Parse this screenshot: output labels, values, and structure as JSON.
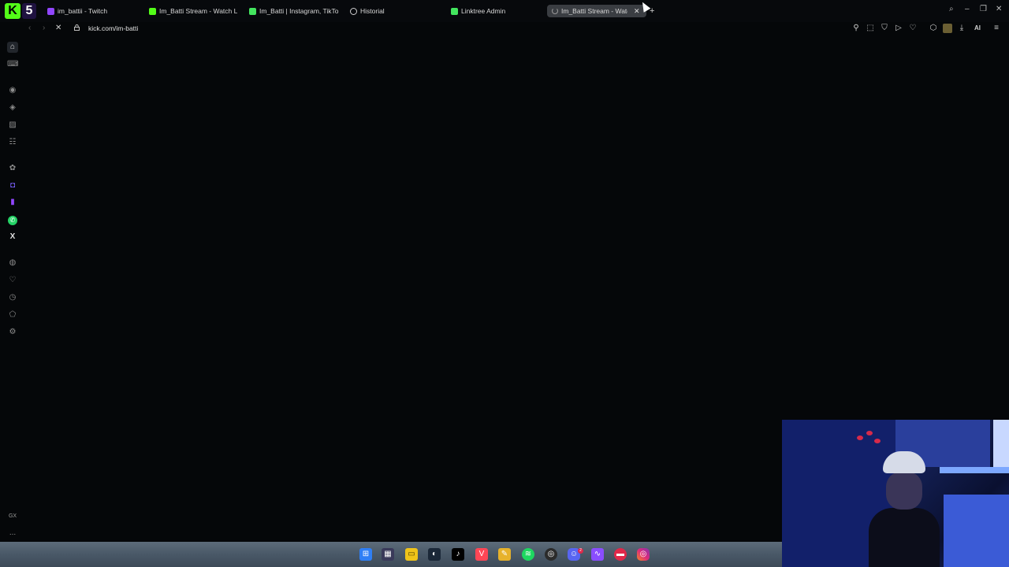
{
  "browser": {
    "logo_k": "K",
    "logo_5": "5",
    "tabs": [
      {
        "title": "im_battii - Twitch",
        "favicon": "twitch-icon"
      },
      {
        "title": "Im_Batti Stream - Watch L",
        "favicon": "kick-icon"
      },
      {
        "title": "Im_Batti | Instagram, TikTo",
        "favicon": "linktree-icon"
      },
      {
        "title": "Historial",
        "favicon": "history-icon"
      },
      {
        "title": "Linktree Admin",
        "favicon": "linktree-icon"
      },
      {
        "title": "Im_Batti Stream - Watc",
        "favicon": "loading-icon",
        "active": true
      }
    ],
    "address": {
      "url": "kick.com/im-batti"
    },
    "toolbar_ai_label": "AI"
  },
  "sidebar": {
    "gx_label": "GX",
    "more_label": "..."
  },
  "colors": {
    "kick_green": "#53fc18",
    "twitch_purple": "#9146ff",
    "page_background": "#050709"
  }
}
